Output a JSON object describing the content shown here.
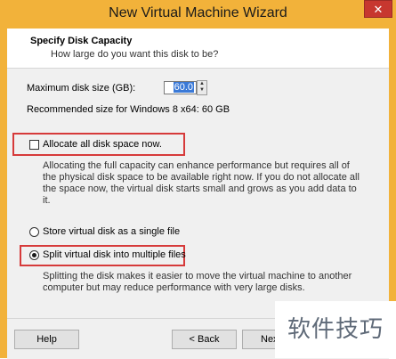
{
  "window": {
    "title": "New Virtual Machine Wizard",
    "close_glyph": "✕"
  },
  "header": {
    "title": "Specify Disk Capacity",
    "subtitle": "How large do you want this disk to be?"
  },
  "disk_size": {
    "label": "Maximum disk size (GB):",
    "value": "60.0",
    "up_glyph": "▲",
    "down_glyph": "▼"
  },
  "recommended": "Recommended size for Windows 8 x64: 60 GB",
  "allocate": {
    "label": "Allocate all disk space now.",
    "checked": false,
    "description": "Allocating the full capacity can enhance performance but requires all of the physical disk space to be available right now. If you do not allocate all the space now, the virtual disk starts small and grows as you add data to it."
  },
  "storage_options": [
    {
      "label": "Store virtual disk as a single file",
      "selected": false
    },
    {
      "label": "Split virtual disk into multiple files",
      "selected": true
    }
  ],
  "split_description": "Splitting the disk makes it easier to move the virtual machine to another computer but may reduce performance with very large disks.",
  "footer": {
    "help_label": "Help",
    "back_label": "< Back",
    "next_label": "Nex"
  },
  "watermark": "软件技巧",
  "colors": {
    "title_bar": "#f2b23a",
    "close_button": "#c7372f",
    "highlight_box": "#d63a3a",
    "selection": "#3a79d7"
  }
}
